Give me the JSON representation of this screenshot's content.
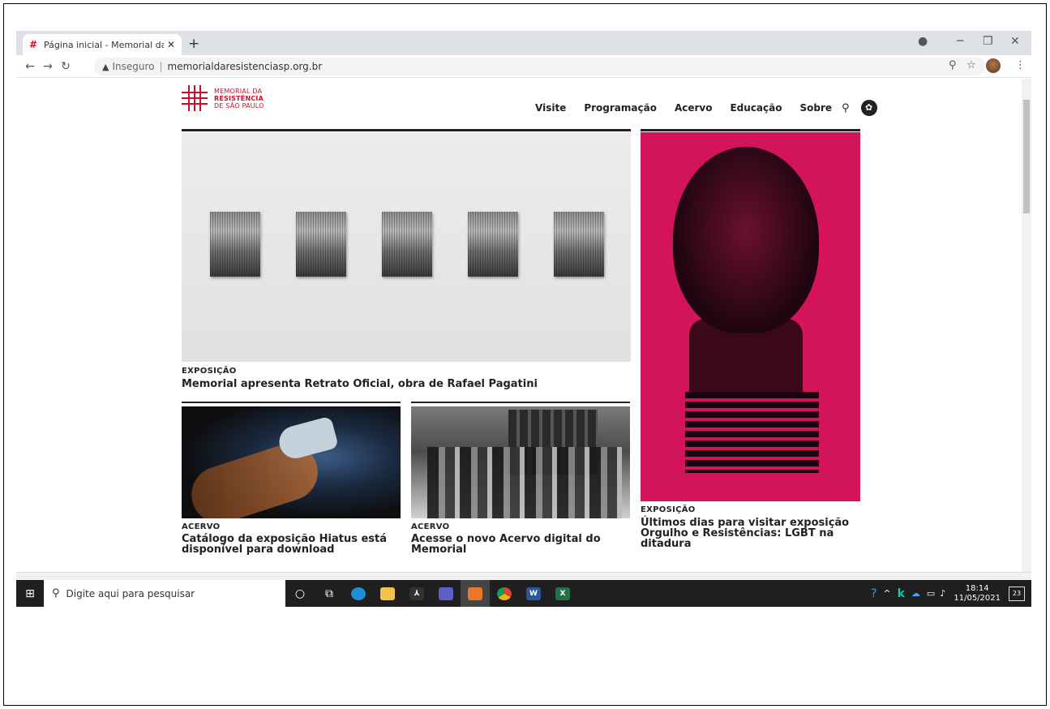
{
  "browser": {
    "tab_title": "Página inicial - Memorial da Resis",
    "tab_close": "✕",
    "new_tab": "+",
    "insecure_label": "Inseguro",
    "separator": "|",
    "url": "memorialdaresistenciasp.org.br"
  },
  "site": {
    "logo_line1": "MEMORIAL DA",
    "logo_line2": "RESISTÊNCIA",
    "logo_line3": "DE SÃO PAULO",
    "nav": [
      "Visite",
      "Programação",
      "Acervo",
      "Educação",
      "Sobre"
    ],
    "brand_color": "#c8102e"
  },
  "feature": {
    "category": "EXPOSIÇÃO",
    "title": "Memorial apresenta Retrato Oficial, obra de Rafael Pagatini"
  },
  "side_feature": {
    "category": "EXPOSIÇÃO",
    "title_line1": "Últimos dias para visitar exposição",
    "title_line2": "Orgulho e Resistências: LGBT na",
    "title_line3": "ditadura",
    "accent_color": "#d4145a"
  },
  "cards": [
    {
      "category": "ACERVO",
      "title_line1": "Catálogo da exposição Hiatus está",
      "title_line2": "disponível para download"
    },
    {
      "category": "ACERVO",
      "title_line1": "Acesse o novo Acervo digital do",
      "title_line2": "Memorial"
    }
  ],
  "taskbar": {
    "search_placeholder": "Digite aqui para pesquisar",
    "time": "18:14",
    "date": "11/05/2021",
    "notifications": "23"
  }
}
